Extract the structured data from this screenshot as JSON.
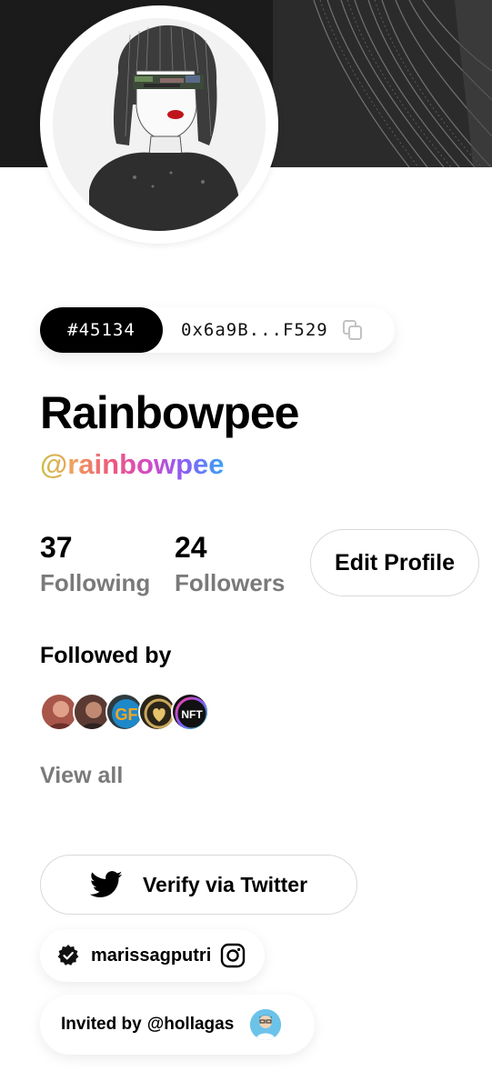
{
  "profile": {
    "token_id": "#45134",
    "wallet_address": "0x6a9B...F529",
    "display_name": "Rainbowpee",
    "handle": "@rainbowpee"
  },
  "stats": {
    "following_count": "37",
    "following_label": "Following",
    "followers_count": "24",
    "followers_label": "Followers"
  },
  "actions": {
    "edit_profile_label": "Edit Profile",
    "verify_twitter_label": "Verify via Twitter"
  },
  "followed_by": {
    "title": "Followed by",
    "view_all_label": "View all",
    "avatars": [
      "avatar-1",
      "avatar-2",
      "avatar-3",
      "avatar-4",
      "avatar-5"
    ]
  },
  "instagram": {
    "username": "marissagputri"
  },
  "invite": {
    "prefix": "Invited by",
    "inviter": "@hollagas"
  },
  "icons": {
    "copy": "copy-icon",
    "twitter": "twitter-bird-icon",
    "verified": "verified-badge-icon",
    "instagram": "instagram-icon"
  },
  "colors": {
    "token_chip": "#000000",
    "secondary_text": "#7a7a7a",
    "twitter_icon": "#000000"
  }
}
